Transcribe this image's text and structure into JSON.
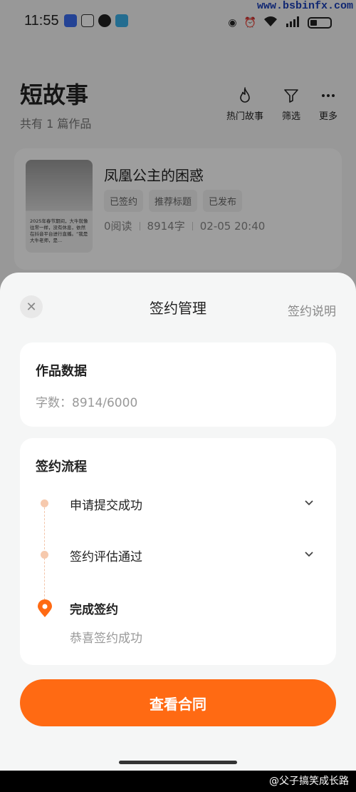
{
  "status_bar": {
    "time": "11:55",
    "watermark": "www.bsbinfx.com"
  },
  "header": {
    "title": "短故事",
    "subtitle": "共有 1 篇作品",
    "actions": [
      {
        "label": "热门故事",
        "icon": "flame-icon"
      },
      {
        "label": "筛选",
        "icon": "filter-icon"
      },
      {
        "label": "更多",
        "icon": "more-icon"
      }
    ]
  },
  "story": {
    "title": "凤凰公主的困惑",
    "cover_text": "2025年春节期间，大牛就像往常一样，没有休息，依然在抖音平台进行直播。“我是大牛老师，是...",
    "tags": [
      "已签约",
      "推荐标题",
      "已发布"
    ],
    "reads": "0阅读",
    "words": "8914字",
    "date": "02-05 20:40"
  },
  "sheet": {
    "title": "签约管理",
    "help": "签约说明",
    "close_icon": "close-icon",
    "data_card": {
      "title": "作品数据",
      "word_count": "字数：8914/6000"
    },
    "flow_card": {
      "title": "签约流程",
      "steps": [
        {
          "label": "申请提交成功"
        },
        {
          "label": "签约评估通过"
        },
        {
          "label": "完成签约",
          "sub": "恭喜签约成功"
        }
      ]
    },
    "button": "查看合同"
  },
  "footer": {
    "credit": "@父子搞笑成长路"
  },
  "colors": {
    "accent": "#ff6a13",
    "timeline_dot": "#f6c9ad"
  }
}
